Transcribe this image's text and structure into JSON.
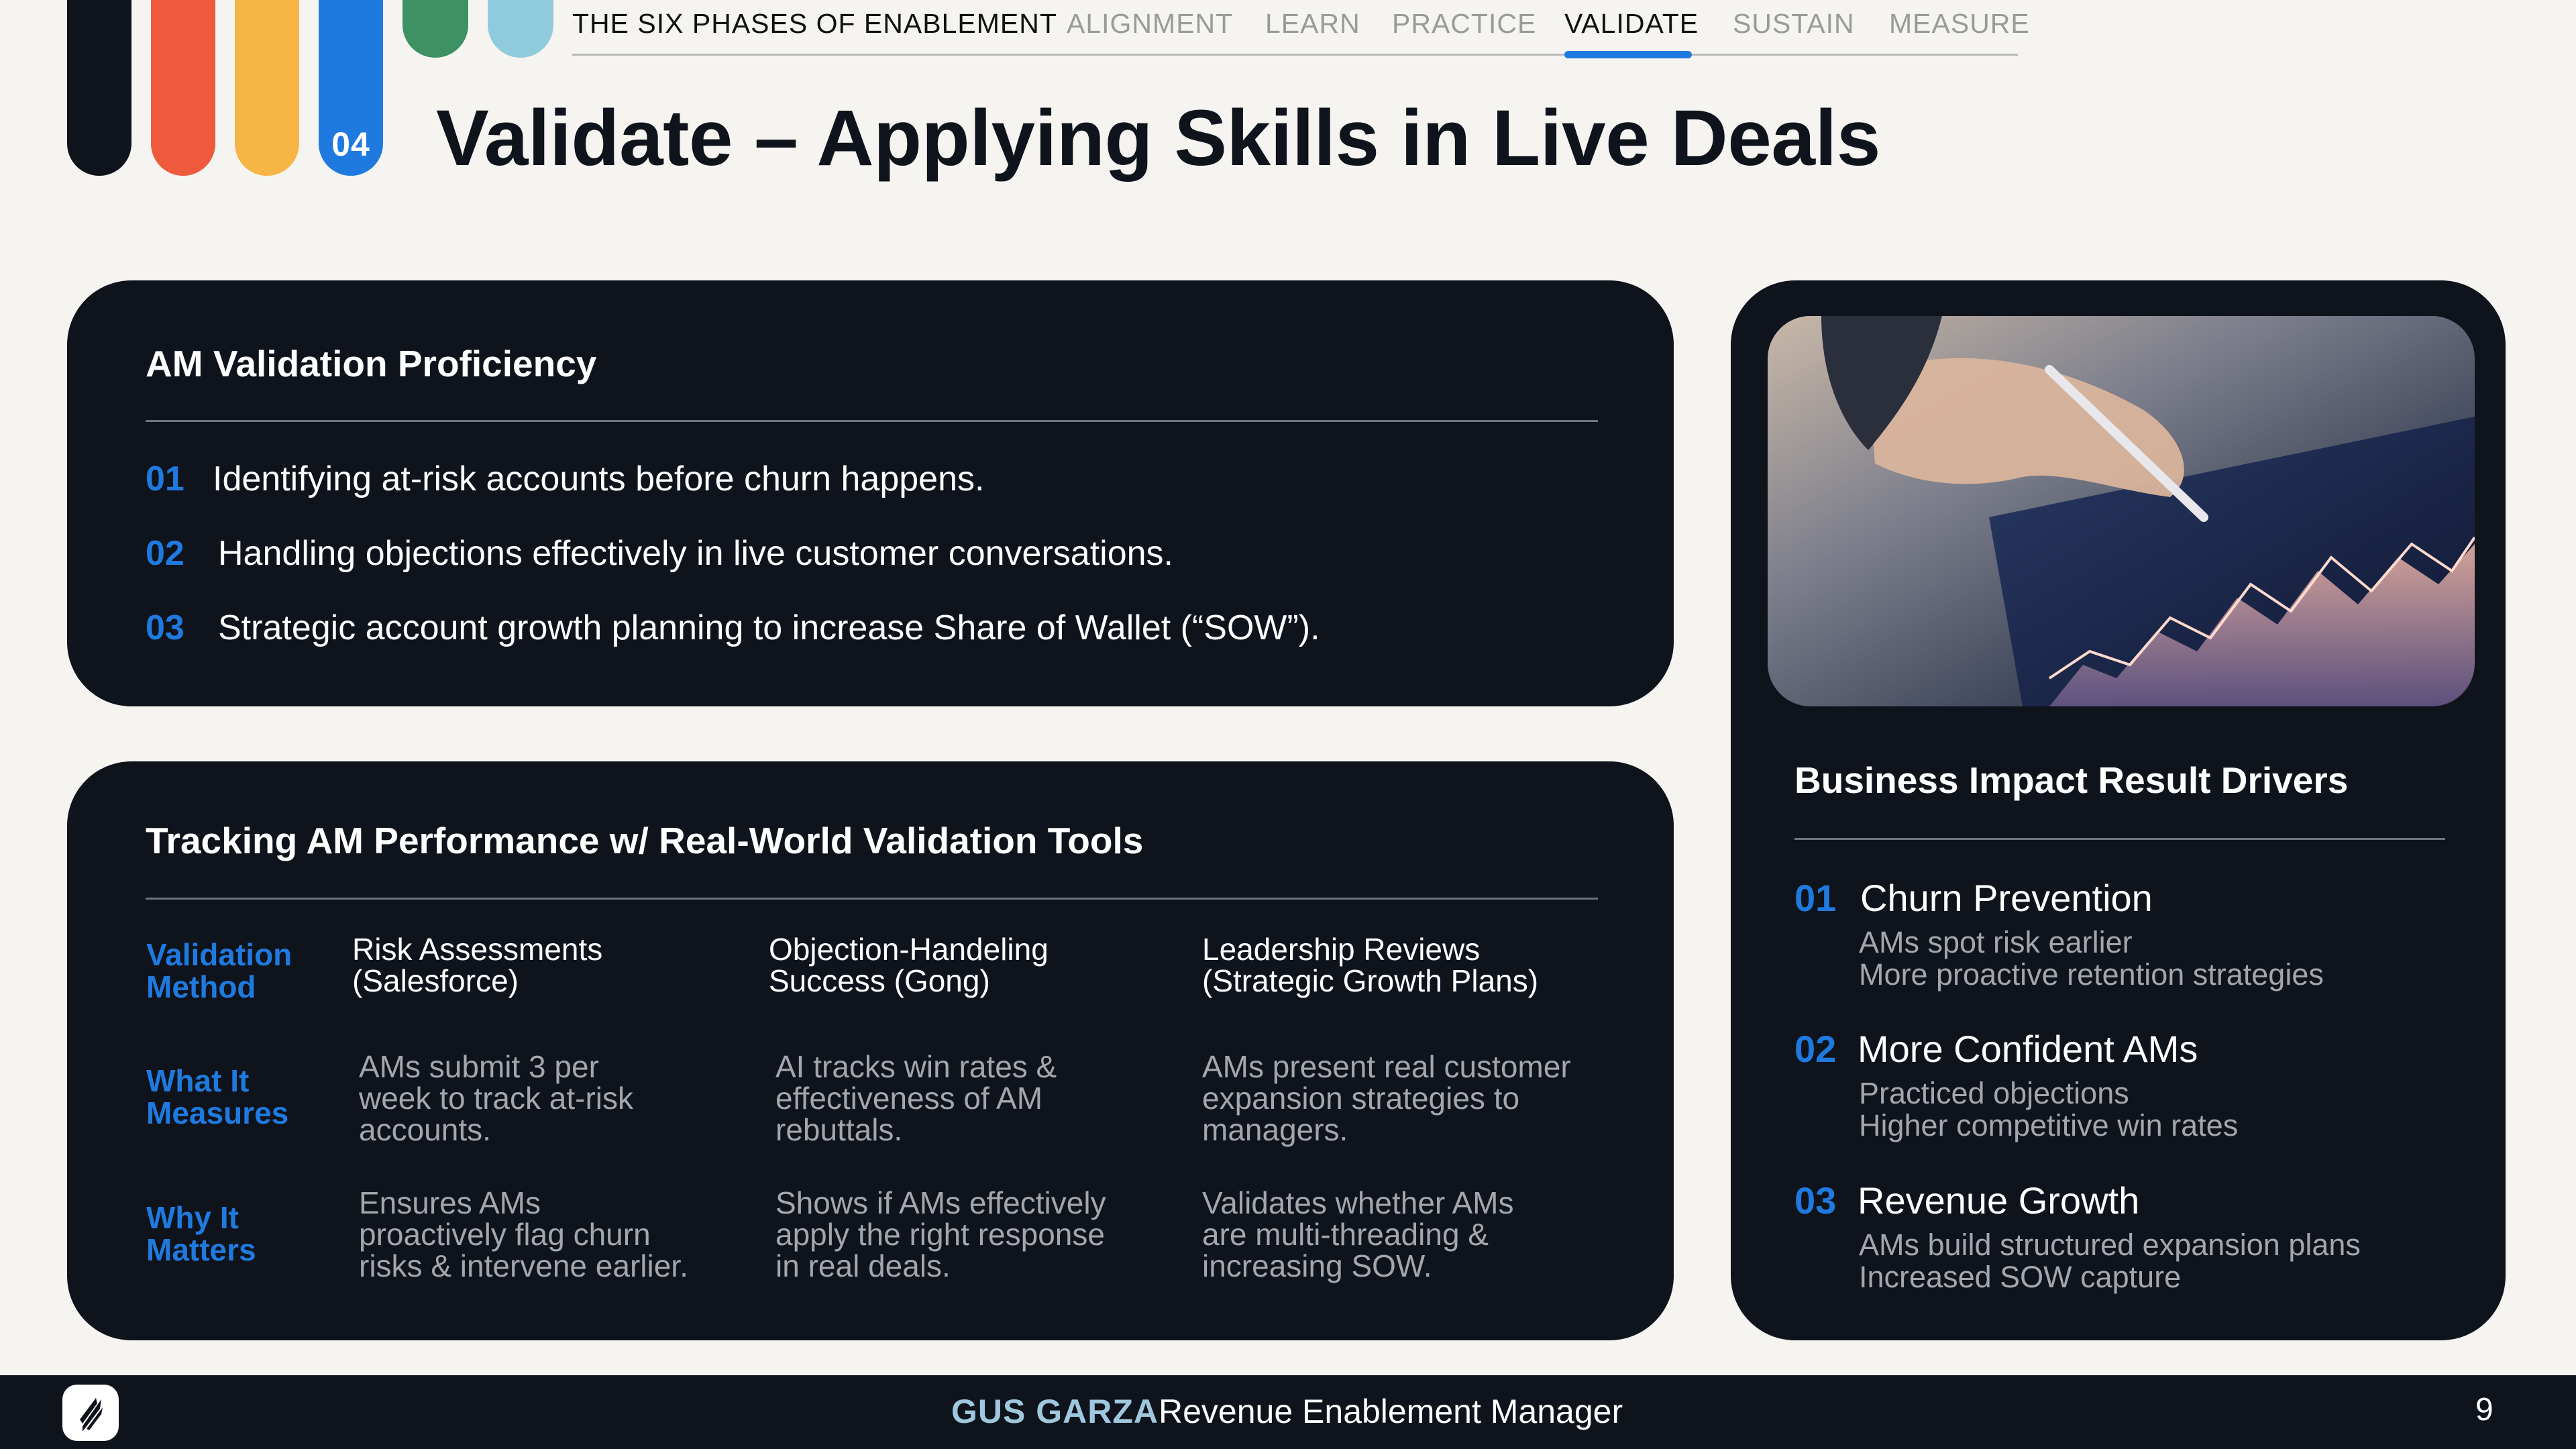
{
  "phase_badge": "04",
  "nav": {
    "section_title": "THE SIX PHASES OF ENABLEMENT",
    "tabs": [
      {
        "label": "ALIGNMENT",
        "active": false
      },
      {
        "label": "LEARN",
        "active": false
      },
      {
        "label": "PRACTICE",
        "active": false
      },
      {
        "label": "VALIDATE",
        "active": true
      },
      {
        "label": "SUSTAIN",
        "active": false
      },
      {
        "label": "MEASURE",
        "active": false
      }
    ],
    "accent": "#1f7ae0"
  },
  "title": "Validate – Applying Skills in Live Deals",
  "colors": {
    "pill_1": "#0f131b",
    "pill_2": "#ee5a3b",
    "pill_3": "#f6b545",
    "pill_4": "#1f7ae0",
    "pill_5": "#3d9163",
    "pill_6": "#8fcbdc",
    "card_bg": "#0f131b",
    "accent_blue": "#1f7ae0",
    "page_bg": "#f5f4f1"
  },
  "proficiency": {
    "heading": "AM Validation Proficiency",
    "items": [
      {
        "num": "01",
        "text": "Identifying at-risk accounts before churn happens."
      },
      {
        "num": "02",
        "text": "Handling objections effectively in live customer conversations."
      },
      {
        "num": "03",
        "text": "Strategic account growth planning to increase Share of Wallet (“SOW”)."
      }
    ]
  },
  "tracking": {
    "heading": "Tracking AM Performance w/ Real-World Validation Tools",
    "row_labels": [
      "Validation Method",
      "What It Measures",
      "Why It Matters"
    ],
    "columns": [
      {
        "method": [
          "Risk Assessments",
          "(Salesforce)"
        ],
        "measures": [
          "AMs submit 3 per",
          "week to track at-risk",
          "accounts."
        ],
        "matters": [
          "Ensures AMs",
          "proactively flag churn",
          "risks & intervene earlier."
        ]
      },
      {
        "method": [
          "Objection-Handeling",
          "Success (Gong)"
        ],
        "measures": [
          "AI tracks win rates &",
          "effectiveness of AM",
          "rebuttals."
        ],
        "matters": [
          "Shows if AMs effectively",
          "apply the right response",
          "in real deals."
        ]
      },
      {
        "method": [
          "Leadership Reviews",
          "(Strategic Growth Plans)"
        ],
        "measures": [
          "AMs present real customer",
          "expansion strategies to",
          "managers."
        ],
        "matters": [
          "Validates whether AMs",
          "are multi-threading &",
          "increasing SOW."
        ]
      }
    ]
  },
  "drivers": {
    "heading": "Business Impact Result Drivers",
    "items": [
      {
        "num": "01",
        "title": "Churn Prevention",
        "lines": [
          "AMs spot risk earlier",
          "More proactive retention strategies"
        ]
      },
      {
        "num": "02",
        "title": "More Confident AMs",
        "lines": [
          "Practiced objections",
          "Higher competitive win rates"
        ]
      },
      {
        "num": "03",
        "title": "Revenue Growth",
        "lines": [
          "AMs build structured expansion plans",
          "Increased SOW capture"
        ]
      }
    ]
  },
  "footer": {
    "name": "GUS GARZA",
    "role": "Revenue Enablement Manager",
    "page_number": "9",
    "logo_icon": "app-logo-icon"
  }
}
